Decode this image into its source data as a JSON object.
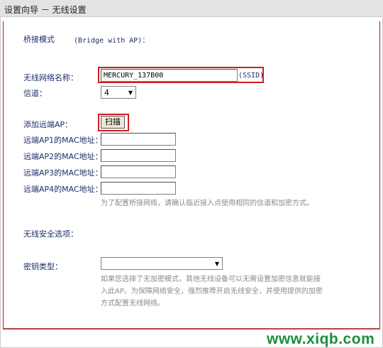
{
  "header": {
    "title": "设置向导 － 无线设置"
  },
  "bridge": {
    "label": "桥接模式",
    "en": "(Bridge with AP)："
  },
  "ssid": {
    "label": "无线网络名称：",
    "value": "MERCURY_137B00",
    "suffix": "(SSID)"
  },
  "channel": {
    "label": "信道：",
    "value": "4"
  },
  "remote": {
    "label": "添加远端AP：",
    "scan_label": "扫描",
    "mac_labels": [
      "远端AP1的MAC地址：",
      "远端AP2的MAC地址：",
      "远端AP3的MAC地址：",
      "远端AP4的MAC地址："
    ],
    "mac_values": [
      "",
      "",
      "",
      ""
    ],
    "note": "为了配置桥接网络，请确认临近接入点使用相同的信道和加密方式。"
  },
  "security": {
    "section_label": "无线安全选项：",
    "key_type_label": "密钥类型：",
    "key_type_value": "",
    "note_lines": [
      "如果您选择了无加密模式，其他无线设备可以无需设置加密信息就能接",
      "入此AP。为保障网络安全，强烈推荐开启无线安全，并使用提供的加密",
      "方式配置无线网络。"
    ]
  },
  "watermark": "www.xiqb.com",
  "colors": {
    "label": "#1a2f6b",
    "highlight": "#d21f1f",
    "note": "#8a8a8a",
    "watermark": "#1a8f3a"
  }
}
